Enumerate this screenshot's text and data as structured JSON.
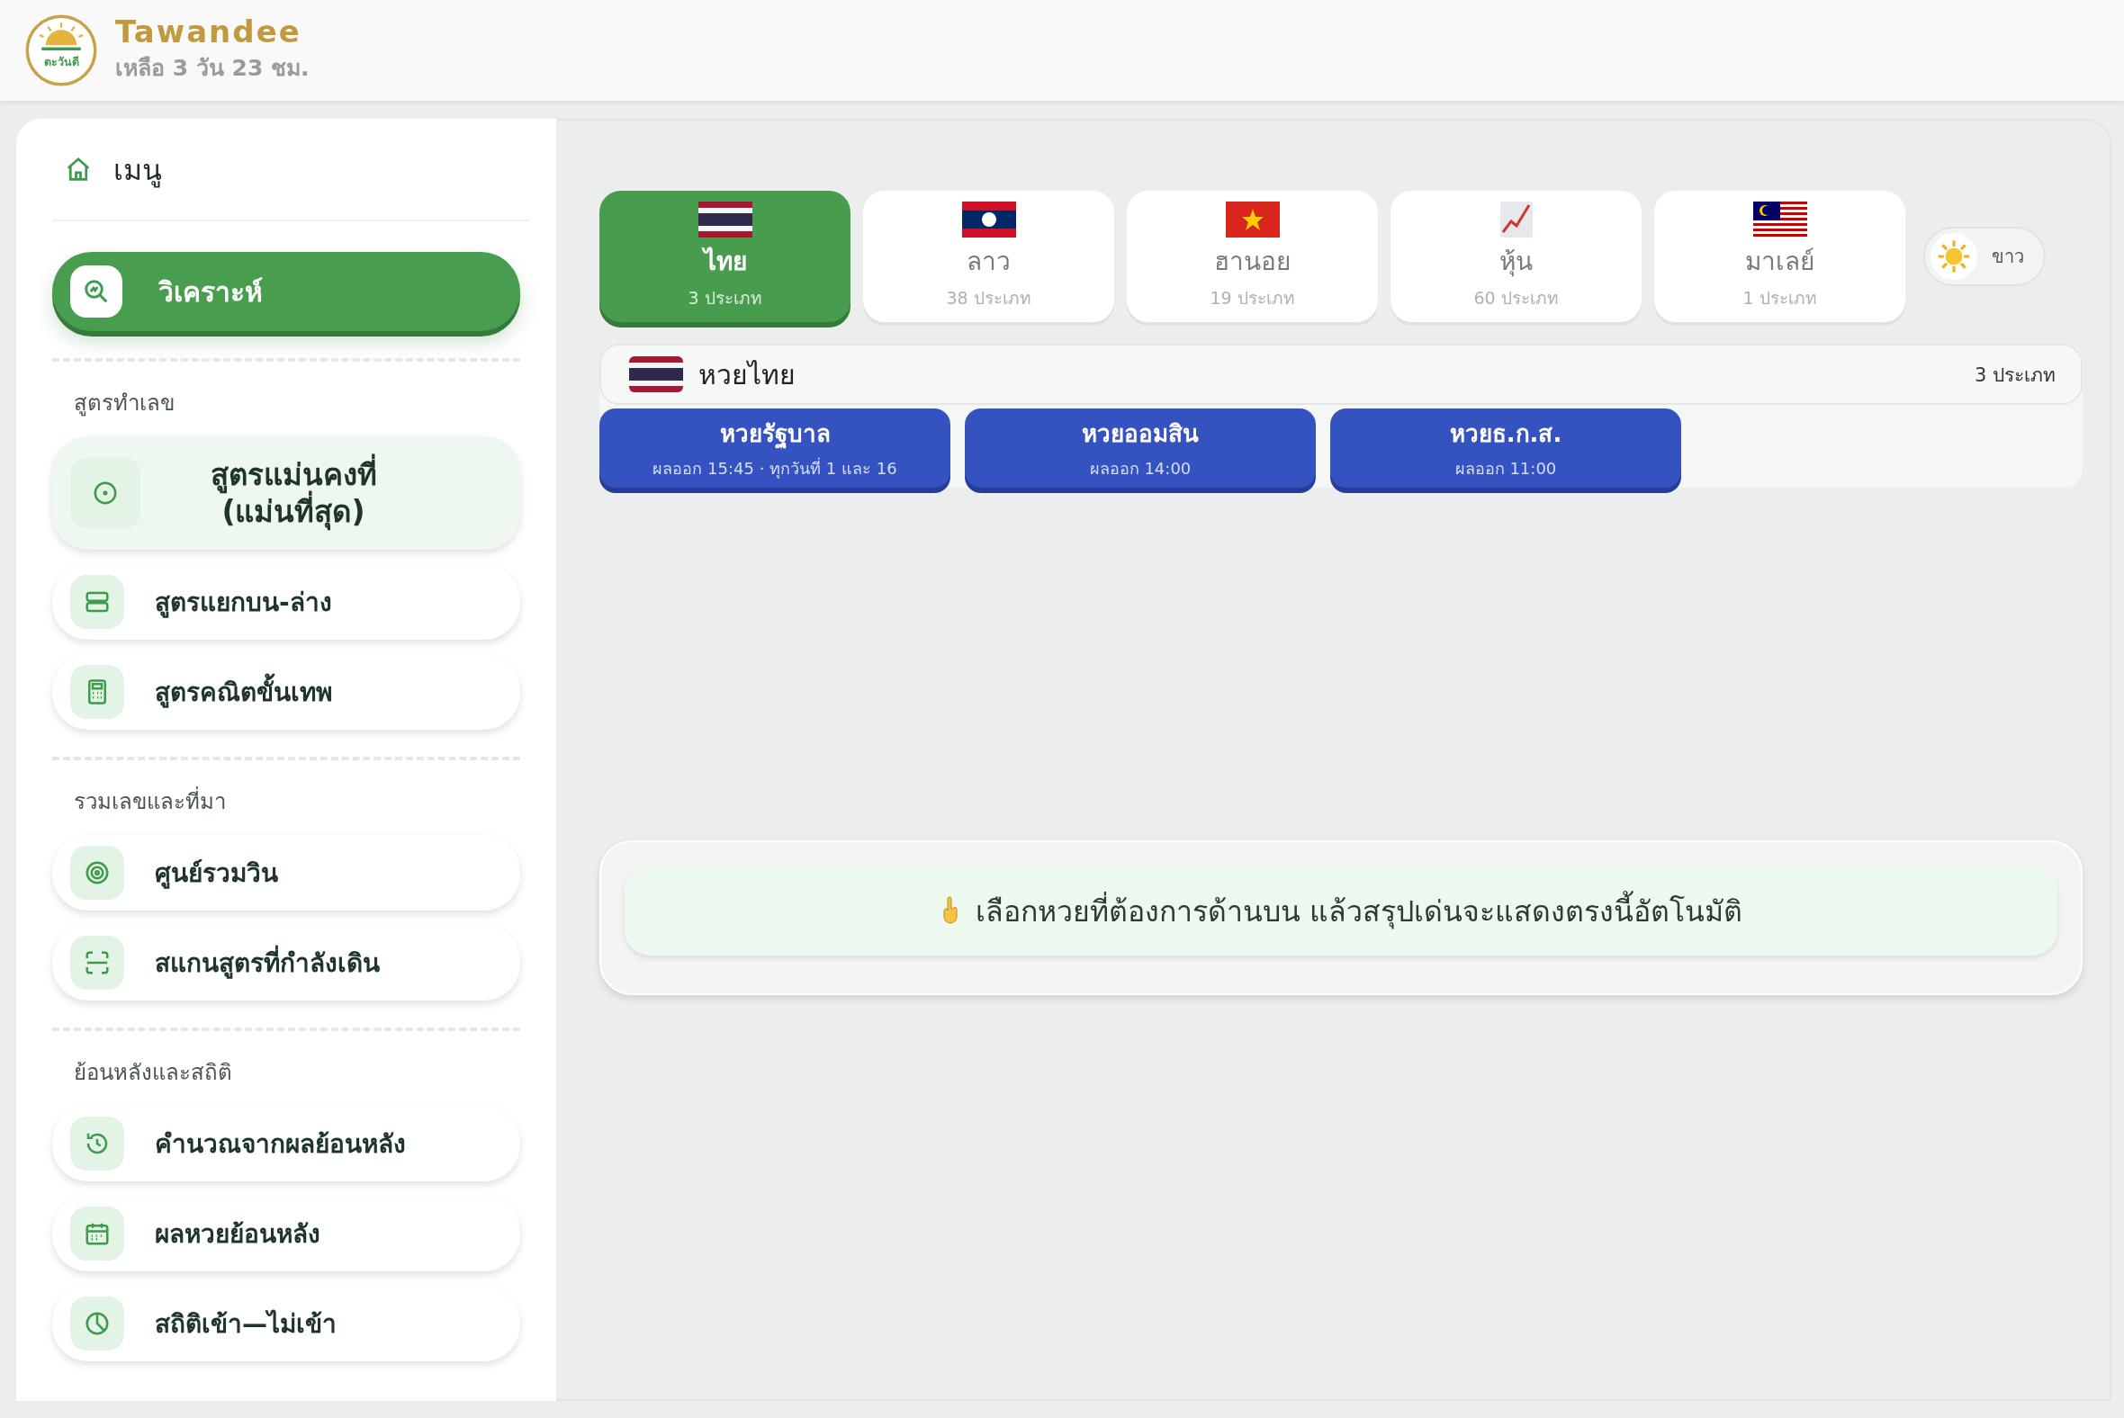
{
  "header": {
    "brand": "Tawandee",
    "countdown": "เหลือ 3 วัน 23 ชม.",
    "logo_text": "ตะวันดี"
  },
  "sidebar": {
    "title": "เมนู",
    "primary": {
      "label": "วิเคราะห์",
      "selected": true
    },
    "sections": [
      {
        "label": "สูตรทำเลข",
        "items": [
          {
            "label": "สูตรแม่นคงที่ (แม่นที่สุด)",
            "kind": "featured"
          },
          {
            "label": "สูตรแยกบน-ล่าง",
            "kind": "plain"
          },
          {
            "label": "สูตรคณิตขั้นเทพ",
            "kind": "plain"
          }
        ]
      },
      {
        "label": "รวมเลขและที่มา",
        "items": [
          {
            "label": "ศูนย์รวมวิน",
            "kind": "plain"
          },
          {
            "label": "สแกนสูตรที่กำลังเดิน",
            "kind": "plain"
          }
        ]
      },
      {
        "label": "ย้อนหลังและสถิติ",
        "items": [
          {
            "label": "คำนวณจากผลย้อนหลัง",
            "kind": "plain"
          },
          {
            "label": "ผลหวยย้อนหลัง",
            "kind": "plain"
          },
          {
            "label": "สถิติเข้า—ไม่เข้า",
            "kind": "plain"
          }
        ]
      }
    ]
  },
  "tabs": [
    {
      "label": "ไทย",
      "count": "3 ประเภท",
      "selected": true
    },
    {
      "label": "ลาว",
      "count": "38 ประเภท",
      "selected": false
    },
    {
      "label": "ฮานอย",
      "count": "19 ประเภท",
      "selected": false
    },
    {
      "label": "หุ้น",
      "count": "60 ประเภท",
      "selected": false
    },
    {
      "label": "มาเลย์",
      "count": "1 ประเภท",
      "selected": false
    }
  ],
  "theme_toggle": {
    "label": "ขาว"
  },
  "lottery_group": {
    "title": "หวยไทย",
    "count": "3 ประเภท",
    "items": [
      {
        "name": "หวยรัฐบาล",
        "schedule": "ผลออก 15:45 · ทุกวันที่ 1 และ 16"
      },
      {
        "name": "หวยออมสิน",
        "schedule": "ผลออก 14:00"
      },
      {
        "name": "หวยธ.ก.ส.",
        "schedule": "ผลออก 11:00"
      }
    ]
  },
  "notice": {
    "text": "เลือกหวยที่ต้องการด้านบน แล้วสรุปเด่นจะแสดงตรงนี้อัตโนมัติ"
  }
}
